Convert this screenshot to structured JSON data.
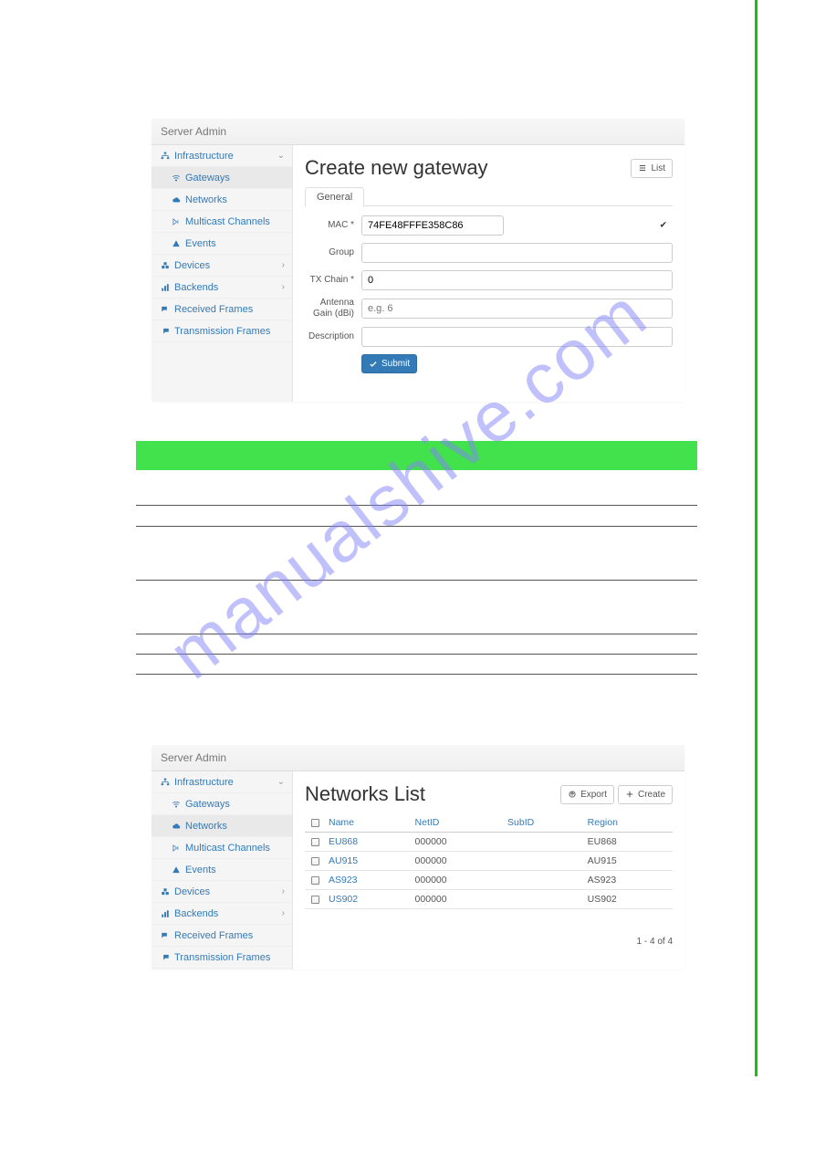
{
  "watermark": "manualshive.com",
  "panel1": {
    "title": "Server Admin",
    "sidebar": {
      "infrastructure": "Infrastructure",
      "gateways": "Gateways",
      "networks": "Networks",
      "multicast": "Multicast Channels",
      "events": "Events",
      "devices": "Devices",
      "backends": "Backends",
      "received": "Received Frames",
      "transmission": "Transmission Frames"
    },
    "content": {
      "title": "Create new gateway",
      "list_btn": "List",
      "tab": "General",
      "labels": {
        "mac": "MAC *",
        "group": "Group",
        "txchain": "TX Chain *",
        "antenna": "Antenna Gain (dBi)",
        "description": "Description"
      },
      "values": {
        "mac": "74FE48FFFE358C86",
        "txchain": "0",
        "antenna_placeholder": "e.g. 6"
      },
      "submit": "Submit"
    }
  },
  "panel2": {
    "title": "Server Admin",
    "sidebar": {
      "infrastructure": "Infrastructure",
      "gateways": "Gateways",
      "networks": "Networks",
      "multicast": "Multicast Channels",
      "events": "Events",
      "devices": "Devices",
      "backends": "Backends",
      "received": "Received Frames",
      "transmission": "Transmission Frames"
    },
    "content": {
      "title": "Networks List",
      "export_btn": "Export",
      "create_btn": "Create",
      "cols": {
        "name": "Name",
        "netid": "NetID",
        "subid": "SubID",
        "region": "Region"
      },
      "rows": [
        {
          "name": "EU868",
          "netid": "000000",
          "subid": "",
          "region": "EU868"
        },
        {
          "name": "AU915",
          "netid": "000000",
          "subid": "",
          "region": "AU915"
        },
        {
          "name": "AS923",
          "netid": "000000",
          "subid": "",
          "region": "AS923"
        },
        {
          "name": "US902",
          "netid": "000000",
          "subid": "",
          "region": "US902"
        }
      ],
      "pager": "1 - 4 of 4"
    }
  }
}
